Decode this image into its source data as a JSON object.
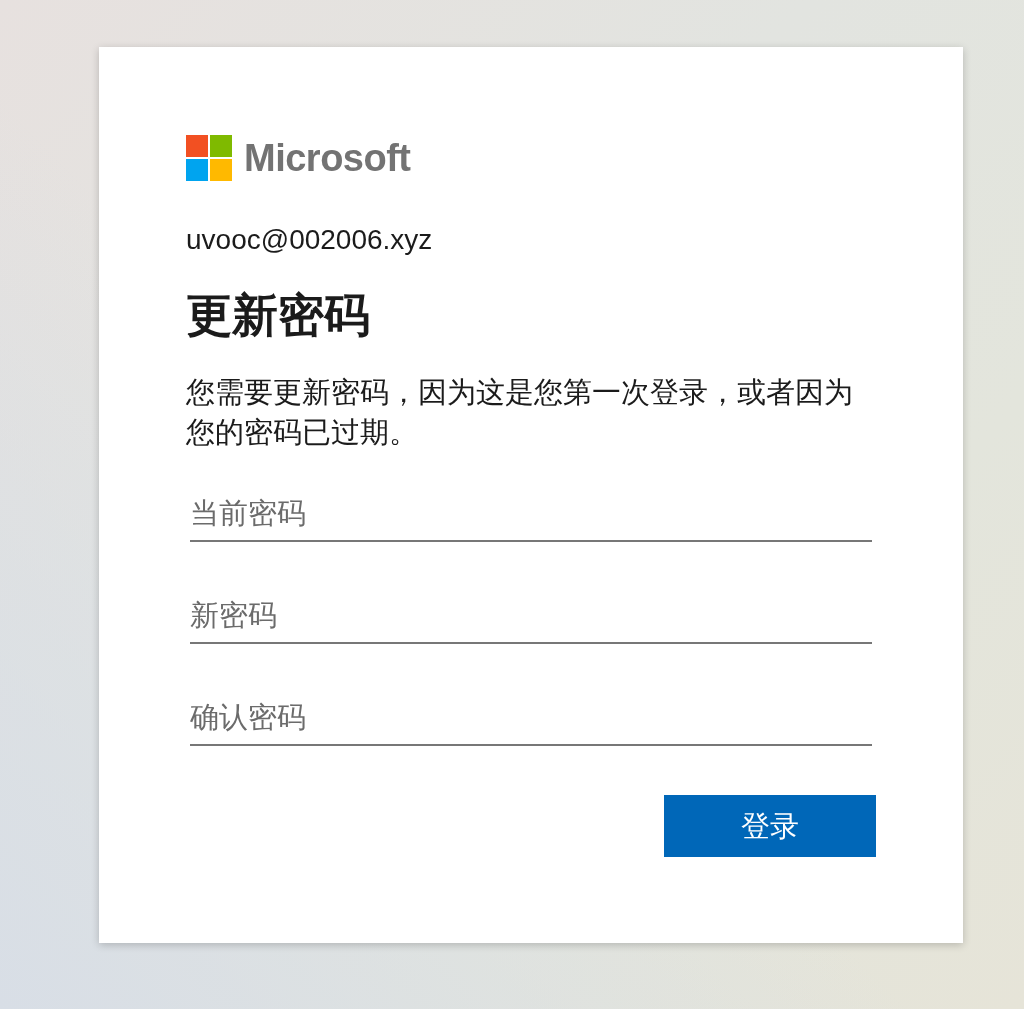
{
  "logo": {
    "wordmark": "Microsoft"
  },
  "account": {
    "email": "uvooc@002006.xyz"
  },
  "title": "更新密码",
  "description": "您需要更新密码，因为这是您第一次登录，或者因为您的密码已过期。",
  "fields": [
    {
      "placeholder": "当前密码"
    },
    {
      "placeholder": "新密码"
    },
    {
      "placeholder": "确认密码"
    }
  ],
  "buttons": [
    {
      "label": "登录"
    }
  ]
}
